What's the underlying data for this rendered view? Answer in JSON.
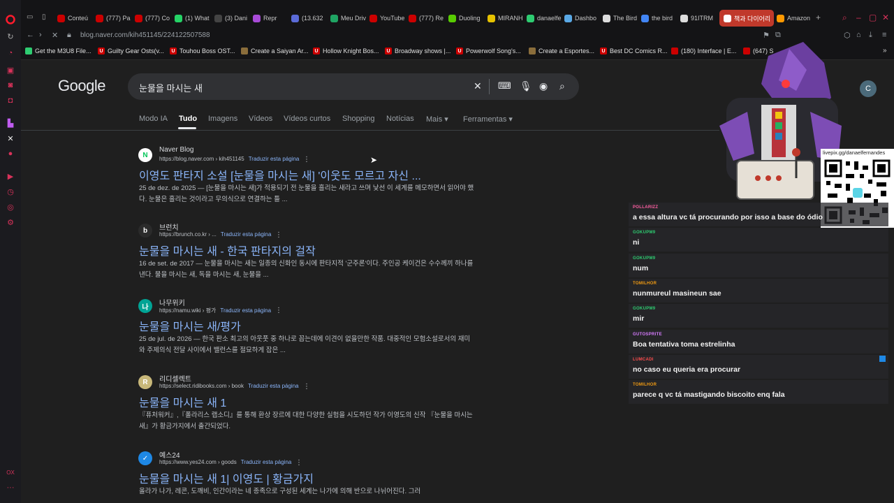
{
  "sidebar": {
    "icons": [
      "opera-logo-icon",
      "refresh-icon",
      "pinboard-icon",
      "bag-icon",
      "chat-icon",
      "instagram-icon",
      "twitch-icon",
      "x-icon",
      "vk-icon",
      "play-icon",
      "clock-icon",
      "settings-icon",
      "gear-icon",
      "ox-icon",
      "more-icon"
    ],
    "labels": {
      "ox": "OX",
      "more": "···"
    }
  },
  "tabs": [
    {
      "label": "Conteú",
      "color": "#cc0000"
    },
    {
      "label": "(777) Pa",
      "color": "#cc0000"
    },
    {
      "label": "(777) Co",
      "color": "#cc0000"
    },
    {
      "label": "(1) What",
      "color": "#25d366"
    },
    {
      "label": "(3) Dani",
      "color": "#444"
    },
    {
      "label": "Repr",
      "color": "#a84bd8"
    },
    {
      "label": "(13.632",
      "color": "#5b6bd8"
    },
    {
      "label": "Meu Driv",
      "color": "#1fa463"
    },
    {
      "label": "YouTube",
      "color": "#cc0000"
    },
    {
      "label": "(777) Re",
      "color": "#cc0000"
    },
    {
      "label": "Duoling",
      "color": "#58cc02"
    },
    {
      "label": "MIRANH",
      "color": "#e6c200"
    },
    {
      "label": "danaelfe",
      "color": "#2ecc71"
    },
    {
      "label": "Dashbo",
      "color": "#5aa9e6"
    },
    {
      "label": "The Bird",
      "color": "#ddd"
    },
    {
      "label": "the bird",
      "color": "#4285f4"
    },
    {
      "label": "91ITRM",
      "color": "#ddd"
    },
    {
      "label": "책과 다이어리 :",
      "color": "#fff"
    },
    {
      "label": "Amazon",
      "color": "#ff9900"
    }
  ],
  "address": {
    "url": "blog.naver.com/kih451145/224122507588"
  },
  "bookmarks": [
    {
      "label": "Get the M3U8 File...",
      "color": "#2ecc71",
      "glyph": ""
    },
    {
      "label": "Guilty Gear Osts(v...",
      "color": "#cc0000",
      "glyph": "U"
    },
    {
      "label": "Touhou Boss OST...",
      "color": "#cc0000",
      "glyph": "U"
    },
    {
      "label": "Create a Saiyan Ar...",
      "color": "#8a6d3b",
      "glyph": ""
    },
    {
      "label": "Hollow Knight Bos...",
      "color": "#cc0000",
      "glyph": "U"
    },
    {
      "label": "Broadway shows |...",
      "color": "#cc0000",
      "glyph": "U"
    },
    {
      "label": "Powerwolf Song's...",
      "color": "#cc0000",
      "glyph": "U"
    },
    {
      "label": "Create a Esportes...",
      "color": "#8a6d3b",
      "glyph": ""
    },
    {
      "label": "Best DC Comics R...",
      "color": "#cc0000",
      "glyph": "U"
    },
    {
      "label": "(180) Interface | E...",
      "color": "#cc0000",
      "glyph": ""
    },
    {
      "label": "(647) S",
      "color": "#cc0000",
      "glyph": ""
    }
  ],
  "google": {
    "logo": "Google",
    "query": "눈물을 마시는 새",
    "avatar_letter": "C",
    "tabs": [
      "Modo IA",
      "Tudo",
      "Imagens",
      "Vídeos",
      "Vídeos curtos",
      "Shopping",
      "Notícias",
      "Mais ▾",
      "Ferramentas ▾"
    ],
    "results": [
      {
        "site": "Naver Blog",
        "url": "https://blog.naver.com › kih451145",
        "translate": "Traduzir esta página",
        "title": "이영도 판타지 소설 [눈물을 마시는 새] '이웃도 모르고 자신 ...",
        "snippet": "25 de dez. de 2025 — [눈물을 마시는 새]가 적용되기 전 눈물을 흘리는 새라고 쓰며 낯선 이 세계를 메모하면서 읽어야 했다. 눈물은 흘리는 것이라고 무의식으로 연결하는 틀 ...",
        "icon": "N",
        "icon_color": "#ffffff",
        "icon_text_color": "#03c75a"
      },
      {
        "site": "브런치",
        "url": "https://brunch.co.kr › ...",
        "translate": "Traduzir esta página",
        "title": "눈물을 마시는 새 - 한국 판타지의 걸작",
        "snippet": "16 de set. de 2017 — 눈물을 마시는 새는 일종의 신화인 동시에 판타지적 '군주론'이다. 주인공 케이건은 수수께끼 하나를 낸다. 물을 마시는 새, 독을 마시는 새, 눈물을 ...",
        "icon": "b",
        "icon_color": "#2b2b2b",
        "icon_text_color": "#ffffff"
      },
      {
        "site": "나무위키",
        "url": "https://namu.wiki › 평가",
        "translate": "Traduzir esta página",
        "title": "눈물을 마시는 새/평가",
        "snippet": "25 de jul. de 2026 — 한국 판소 최고의 아웃풋 중 하나로 꼽는데에 이견이 없을만한 작품. 대중적인 모험소설로서의 재미와 주제의식 전달 사이에서 밸런스를 절묘하게 잡은 ...",
        "icon": "나",
        "icon_color": "#00a495",
        "icon_text_color": "#ffffff"
      },
      {
        "site": "리디셀렉트",
        "url": "https://select.ridibooks.com › book",
        "translate": "Traduzir esta página",
        "title": "눈물을 마시는 새 1",
        "snippet": "『퓨처워커』,『폴라리스 랩소디』를 통해 환상 장르에 대한 다양한 실험을 시도하던 작가 이영도의 신작 『눈물을 마시는 새』가 황금가지에서 출간되었다.",
        "icon": "R",
        "icon_color": "#c8b87a",
        "icon_text_color": "#ffffff"
      },
      {
        "site": "예스24",
        "url": "https://www.yes24.com › goods",
        "translate": "Traduzir esta página",
        "title": "눈물을 마시는 새 1| 이영도 | 황금가지",
        "snippet": "올라가 나가, 레콘, 도깨비, 인간이라는 네 종족으로 구성된 세계는 나가에 의해 반으로 나뉘어진다. 그러",
        "icon": "✓",
        "icon_color": "#1e88e5",
        "icon_text_color": "#ffffff"
      }
    ]
  },
  "stream": {
    "qr_link": "livepix.gg/danaelfernandes",
    "chat": [
      {
        "user": "POLLARIZZ",
        "color": "#ff5fa2",
        "text": "a essa altura vc tá procurando por isso a base do ódio"
      },
      {
        "user": "GOKUPM9",
        "color": "#2ecc71",
        "text": "ni"
      },
      {
        "user": "GOKUPM9",
        "color": "#2ecc71",
        "text": "num"
      },
      {
        "user": "TOMILHOR",
        "color": "#f39c12",
        "text": "nunmureul masineun sae"
      },
      {
        "user": "GOKUPM9",
        "color": "#2ecc71",
        "text": "mir"
      },
      {
        "user": "GUTOSPRITE",
        "color": "#d77bff",
        "text": "Boa tentativa toma estrelinha"
      },
      {
        "user": "LUMCADI",
        "color": "#ff4d4d",
        "text": "no caso eu queria era procurar"
      },
      {
        "user": "TOMILHOR",
        "color": "#f39c12",
        "text": "parece q vc tá mastigando biscoito enq fala"
      }
    ]
  }
}
